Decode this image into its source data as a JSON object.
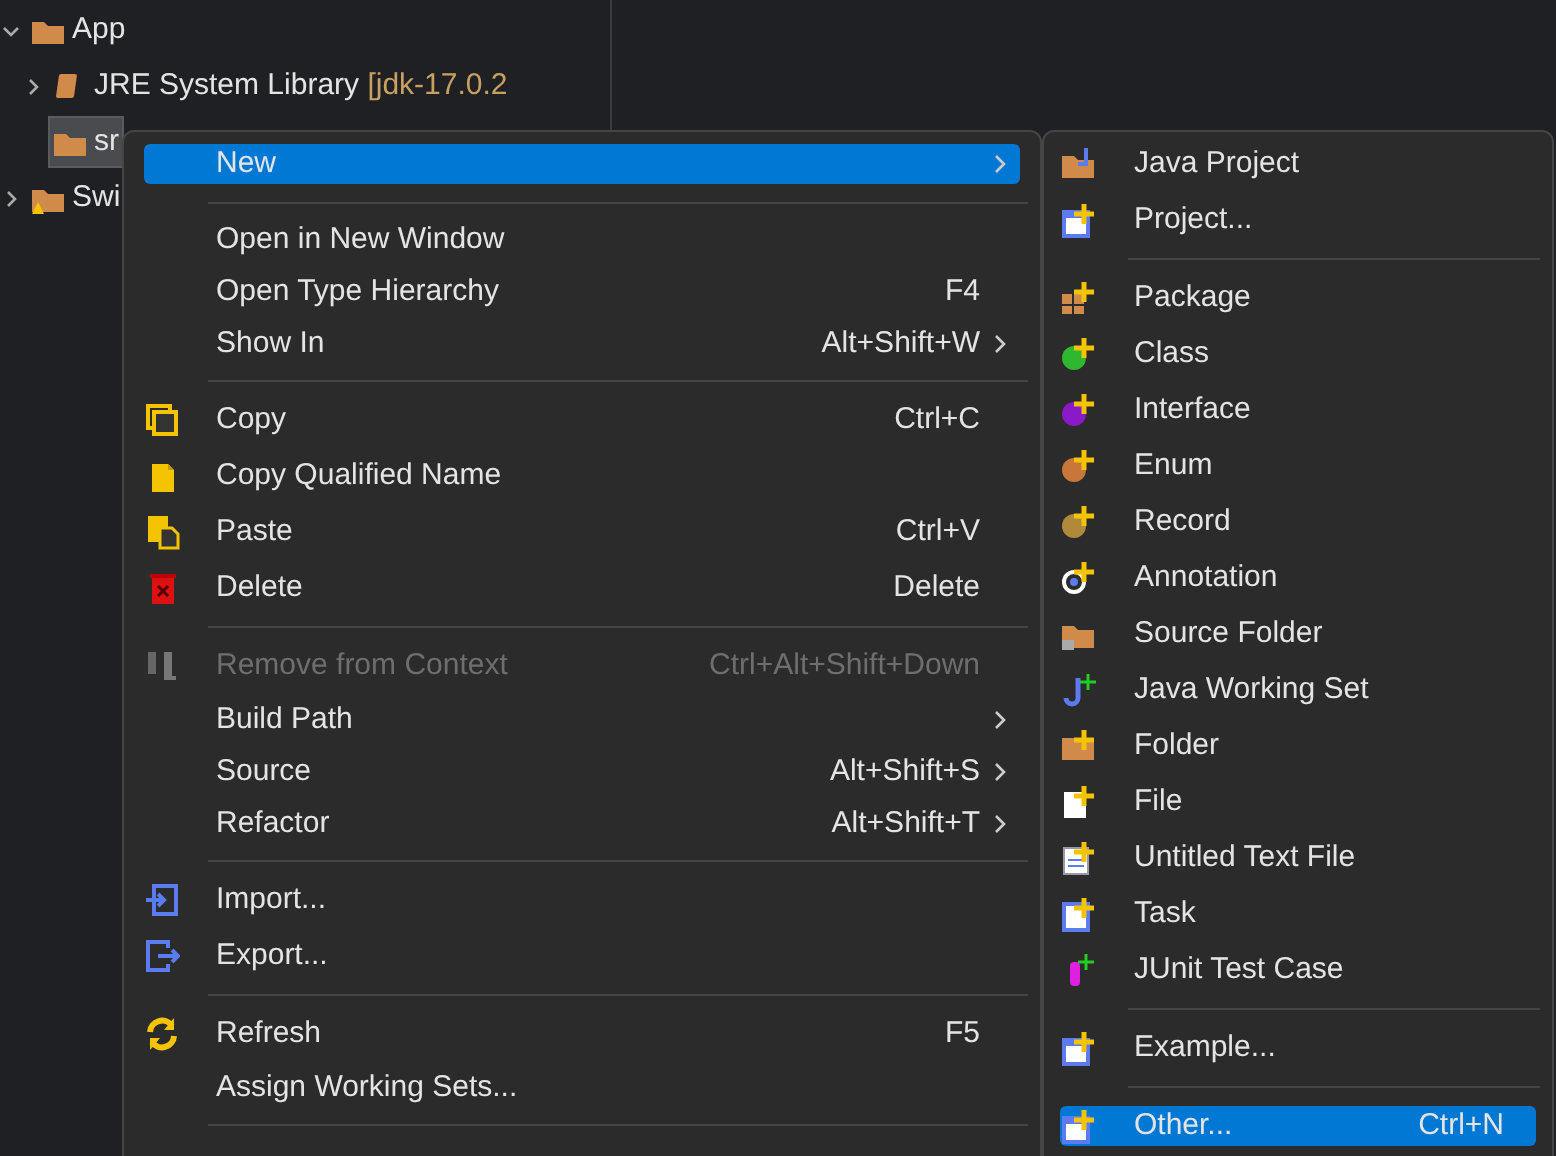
{
  "tree": [
    {
      "label": "App",
      "expanded": true,
      "selected": false,
      "warning": false,
      "children": [
        {
          "label": "JRE System Library",
          "suffix": "[jdk-17.0.2",
          "expanded": false,
          "selected": false,
          "warning": false
        },
        {
          "label": "sr",
          "selected": true,
          "warning": false
        }
      ]
    },
    {
      "label": "Swi",
      "expanded": false,
      "selected": false,
      "warning": true
    }
  ],
  "context_menu": {
    "items": [
      {
        "label": "New",
        "submenu": true,
        "selected": true,
        "disabled": false
      },
      {
        "kind": "separator"
      },
      {
        "label": "Open in New Window",
        "submenu": false,
        "selected": false,
        "disabled": false
      },
      {
        "label": "Open Type Hierarchy",
        "shortcut": "F4",
        "submenu": false,
        "selected": false,
        "disabled": false
      },
      {
        "label": "Show In",
        "shortcut": "Alt+Shift+W",
        "submenu": true,
        "selected": false,
        "disabled": false
      },
      {
        "kind": "separator"
      },
      {
        "label": "Copy",
        "shortcut": "Ctrl+C",
        "submenu": false,
        "selected": false,
        "disabled": false
      },
      {
        "label": "Copy Qualified Name",
        "submenu": false,
        "selected": false,
        "disabled": false
      },
      {
        "label": "Paste",
        "shortcut": "Ctrl+V",
        "submenu": false,
        "selected": false,
        "disabled": false
      },
      {
        "label": "Delete",
        "shortcut": "Delete",
        "submenu": false,
        "selected": false,
        "disabled": false
      },
      {
        "kind": "separator"
      },
      {
        "label": "Remove from Context",
        "shortcut": "Ctrl+Alt+Shift+Down",
        "submenu": false,
        "selected": false,
        "disabled": true
      },
      {
        "label": "Build Path",
        "submenu": true,
        "selected": false,
        "disabled": false
      },
      {
        "label": "Source",
        "shortcut": "Alt+Shift+S",
        "submenu": true,
        "selected": false,
        "disabled": false
      },
      {
        "label": "Refactor",
        "shortcut": "Alt+Shift+T",
        "submenu": true,
        "selected": false,
        "disabled": false
      },
      {
        "kind": "separator"
      },
      {
        "label": "Import...",
        "submenu": false,
        "selected": false,
        "disabled": false
      },
      {
        "label": "Export...",
        "submenu": false,
        "selected": false,
        "disabled": false
      },
      {
        "kind": "separator"
      },
      {
        "label": "Refresh",
        "shortcut": "F5",
        "submenu": false,
        "selected": false,
        "disabled": false
      },
      {
        "label": "Assign Working Sets...",
        "submenu": false,
        "selected": false,
        "disabled": false
      },
      {
        "kind": "separator"
      }
    ]
  },
  "new_submenu": {
    "items": [
      {
        "label": "Java Project",
        "selected": false
      },
      {
        "label": "Project...",
        "selected": false
      },
      {
        "kind": "separator"
      },
      {
        "label": "Package",
        "selected": false
      },
      {
        "label": "Class",
        "selected": false
      },
      {
        "label": "Interface",
        "selected": false
      },
      {
        "label": "Enum",
        "selected": false
      },
      {
        "label": "Record",
        "selected": false
      },
      {
        "label": "Annotation",
        "selected": false
      },
      {
        "label": "Source Folder",
        "selected": false
      },
      {
        "label": "Java Working Set",
        "selected": false
      },
      {
        "label": "Folder",
        "selected": false
      },
      {
        "label": "File",
        "selected": false
      },
      {
        "label": "Untitled Text File",
        "selected": false
      },
      {
        "label": "Task",
        "selected": false
      },
      {
        "label": "JUnit Test Case",
        "selected": false
      },
      {
        "kind": "separator"
      },
      {
        "label": "Example...",
        "selected": false
      },
      {
        "kind": "separator"
      },
      {
        "label": "Other...",
        "shortcut": "Ctrl+N",
        "selected": true
      }
    ]
  }
}
